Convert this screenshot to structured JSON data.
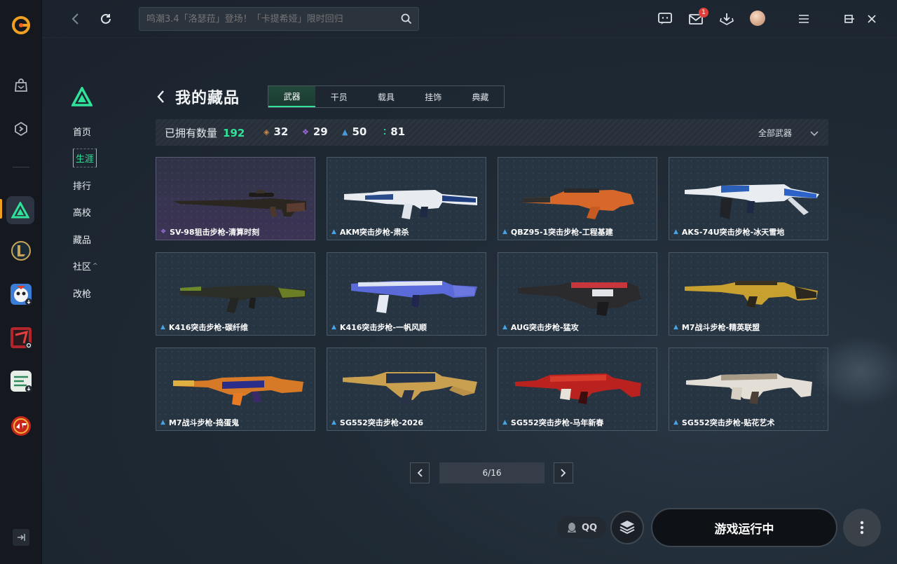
{
  "search": {
    "placeholder": "鸣潮3.4「洛瑟菈」登场！「卡提希娅」限时回归"
  },
  "topbar": {
    "mail_badge": "1"
  },
  "sidenav": {
    "items": [
      {
        "label": "首页"
      },
      {
        "label": "生涯"
      },
      {
        "label": "排行"
      },
      {
        "label": "高校"
      },
      {
        "label": "藏品"
      },
      {
        "label": "社区"
      },
      {
        "label": "改枪"
      }
    ]
  },
  "header": {
    "title": "我的藏品"
  },
  "tabs": [
    {
      "label": "武器"
    },
    {
      "label": "干员"
    },
    {
      "label": "载具"
    },
    {
      "label": "挂饰"
    },
    {
      "label": "典藏"
    }
  ],
  "stats": {
    "owned_label": "已拥有数量",
    "owned_count": "192",
    "counts": [
      {
        "value": "32",
        "color": "#d08a4a",
        "icon": "diamond-orange"
      },
      {
        "value": "29",
        "color": "#a066e0",
        "icon": "diamond-purple"
      },
      {
        "value": "50",
        "color": "#4a9ad8",
        "icon": "chevron-blue"
      },
      {
        "value": "81",
        "color": "#2fe39a",
        "icon": "dots-green"
      }
    ],
    "filter": "全部武器"
  },
  "colors": {
    "accent": "#2fe39a",
    "rare_blue": "#4a9ad8",
    "epic_purple": "#a066e0"
  },
  "items": [
    {
      "name": "SV-98狙击步枪-清算时刻",
      "rarity": "epic"
    },
    {
      "name": "AKM突击步枪-肃杀",
      "rarity": "rare"
    },
    {
      "name": "QBZ95-1突击步枪-工程基建",
      "rarity": "rare"
    },
    {
      "name": "AKS-74U突击步枪-冰天雪地",
      "rarity": "rare"
    },
    {
      "name": "K416突击步枪-碳纤维",
      "rarity": "rare"
    },
    {
      "name": "K416突击步枪-一帆风顺",
      "rarity": "rare"
    },
    {
      "name": "AUG突击步枪-猛攻",
      "rarity": "rare"
    },
    {
      "name": "M7战斗步枪-精英联盟",
      "rarity": "rare"
    },
    {
      "name": "M7战斗步枪-捣蛋鬼",
      "rarity": "rare"
    },
    {
      "name": "SG552突击步枪-2026",
      "rarity": "rare"
    },
    {
      "name": "SG552突击步枪-马年新春",
      "rarity": "rare"
    },
    {
      "name": "SG552突击步枪-贴花艺术",
      "rarity": "rare"
    }
  ],
  "pager": {
    "text": "6/16"
  },
  "bottom": {
    "qq_label": "QQ",
    "run_label": "游戏运行中"
  }
}
